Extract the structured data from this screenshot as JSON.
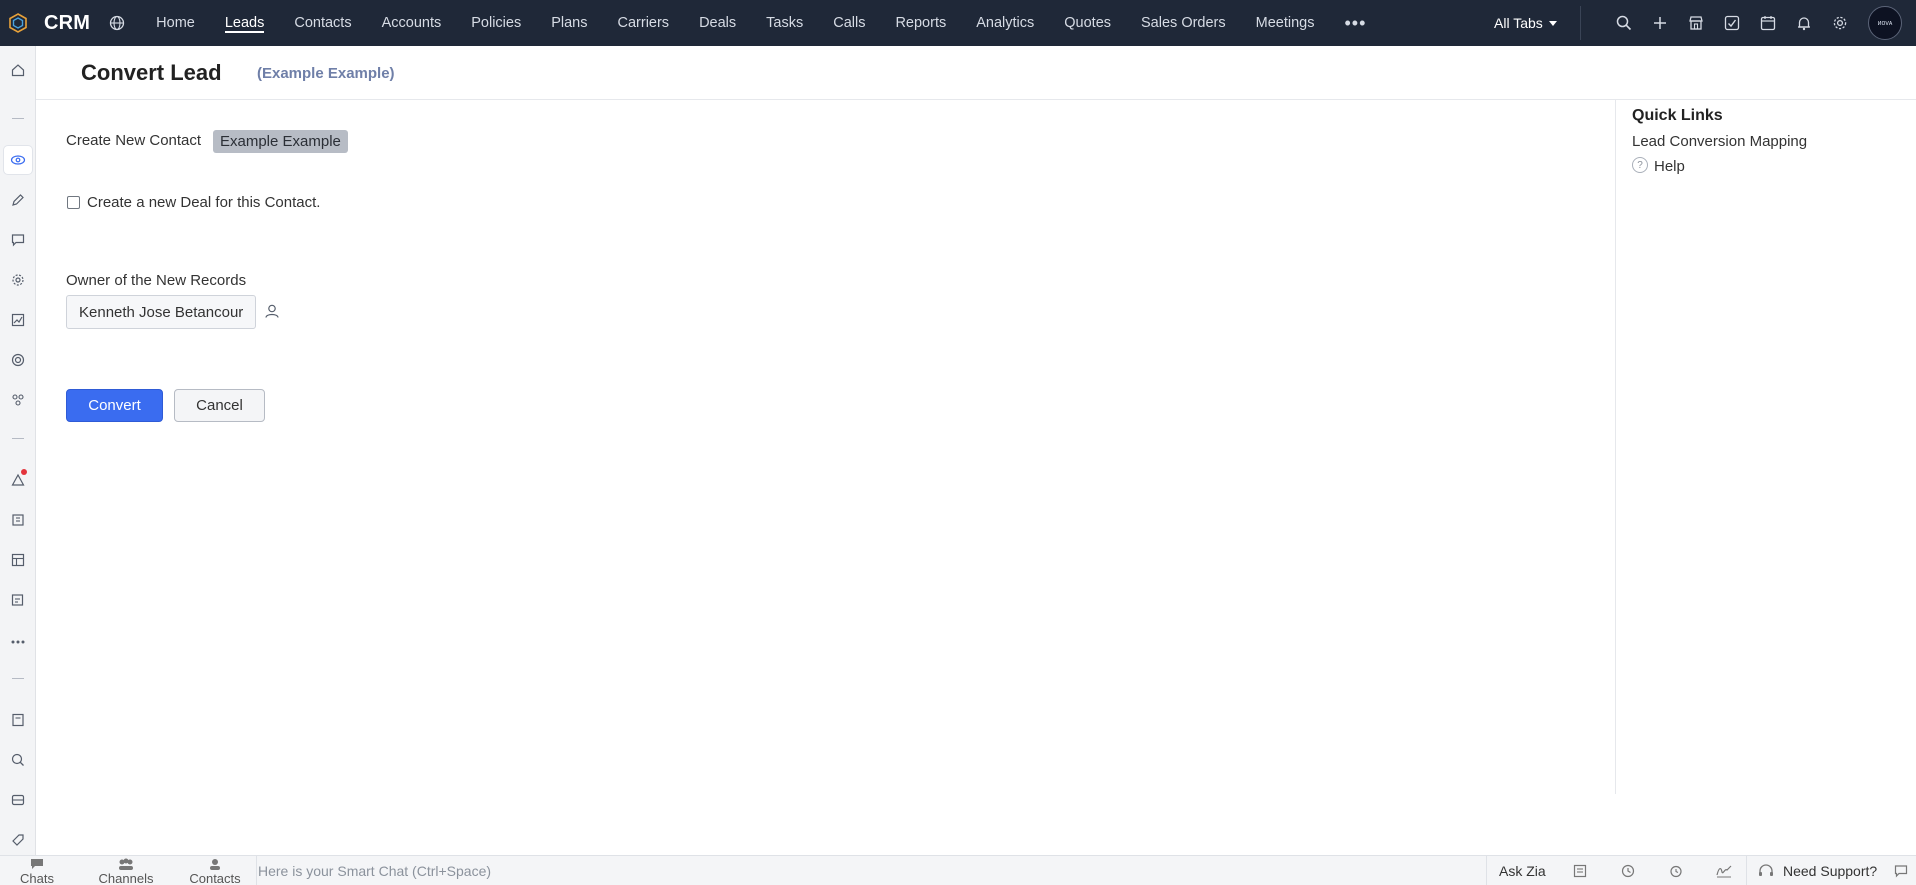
{
  "app": {
    "title": "CRM"
  },
  "nav": {
    "items": [
      "Home",
      "Leads",
      "Contacts",
      "Accounts",
      "Policies",
      "Plans",
      "Carriers",
      "Deals",
      "Tasks",
      "Calls",
      "Reports",
      "Analytics",
      "Quotes",
      "Sales Orders",
      "Meetings"
    ],
    "active": "Leads",
    "more": "•••",
    "all_tabs": "All Tabs"
  },
  "avatar": {
    "text": "ᴎᴏᴠᴀ"
  },
  "header": {
    "title": "Convert Lead",
    "subtitle": "(Example Example)"
  },
  "form": {
    "create_contact_label": "Create New Contact",
    "contact_name": "Example Example",
    "deal_checkbox_label": "Create a new Deal for this Contact.",
    "deal_checked": false,
    "owner_label": "Owner of the New Records",
    "owner_value": "Kenneth Jose Betancour",
    "convert_label": "Convert",
    "cancel_label": "Cancel"
  },
  "quick_links": {
    "title": "Quick Links",
    "mapping": "Lead Conversion Mapping",
    "help": "Help",
    "help_icon_glyph": "?"
  },
  "bottom": {
    "chats": "Chats",
    "channels": "Channels",
    "contacts": "Contacts",
    "smart_chat_placeholder": "Here is your Smart Chat (Ctrl+Space)",
    "ask_zia": "Ask Zia",
    "need_support": "Need Support?"
  },
  "colors": {
    "topbar": "#1f2838",
    "primary_button": "#3a6cf0",
    "subtitle": "#6f7fa8",
    "notification_dot": "#e3343c"
  }
}
